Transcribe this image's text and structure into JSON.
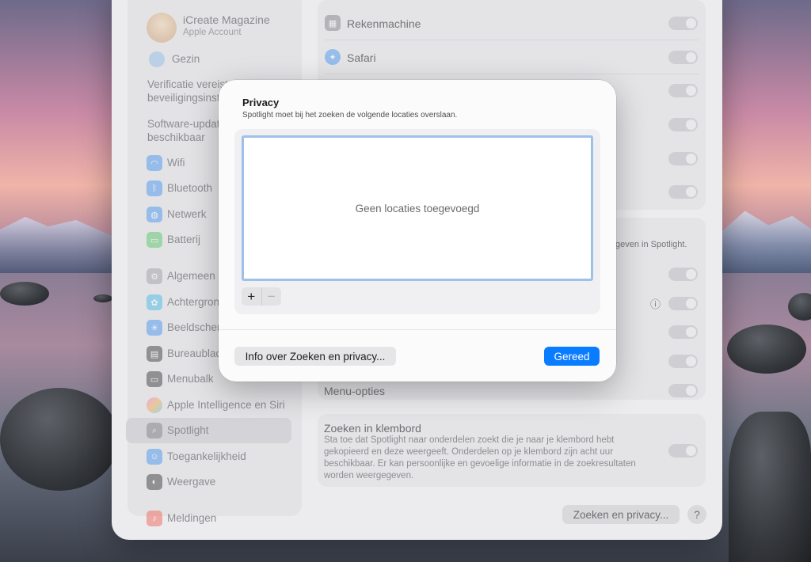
{
  "sidebar": {
    "account_name": "iCreate Magazine",
    "account_sub": "Apple Account",
    "family": "Gezin",
    "notice_1": [
      "Verificatie vereist v",
      "beveiligingsinstelli"
    ],
    "notice_2": [
      "Software-update",
      "beschikbaar"
    ],
    "items": [
      {
        "label": "Wifi",
        "icon": "wifi-icon"
      },
      {
        "label": "Bluetooth",
        "icon": "bluetooth-icon"
      },
      {
        "label": "Netwerk",
        "icon": "globe-icon"
      },
      {
        "label": "Batterij",
        "icon": "battery-icon"
      },
      {
        "label": "Algemeen",
        "icon": "gear-icon"
      },
      {
        "label": "Achtergrond",
        "icon": "flower-icon"
      },
      {
        "label": "Beeldscherm",
        "icon": "sun-icon"
      },
      {
        "label": "Bureaublad en",
        "icon": "desktop-icon"
      },
      {
        "label": "Menubalk",
        "icon": "menubar-icon"
      },
      {
        "label": "Apple Intelligence en Siri",
        "icon": "siri-icon"
      },
      {
        "label": "Spotlight",
        "icon": "magnifier-icon"
      },
      {
        "label": "Toegankelijkheid",
        "icon": "accessibility-icon"
      },
      {
        "label": "Weergave",
        "icon": "appearance-icon"
      },
      {
        "label": "Meldingen",
        "icon": "bell-icon"
      }
    ],
    "selected": "Spotlight"
  },
  "content": {
    "rows_top": [
      "Rekenmachine",
      "Safari"
    ],
    "spotlight_partial": "geven in Spotlight.",
    "menu_options": "Menu-opties",
    "clipboard": {
      "title": "Zoeken in klembord",
      "description": [
        "Sta toe dat Spotlight naar onderdelen zoekt die je naar je klembord hebt",
        "gekopieerd en deze weergeeft. Onderdelen op je klembord zijn acht uur",
        "beschikbaar. Er kan persoonlijke en gevoelige informatie in de zoekresultaten",
        "worden weergegeven."
      ]
    },
    "privacy_button": "Zoeken en privacy...",
    "help_button": "?"
  },
  "modal": {
    "title": "Privacy",
    "subtitle": "Spotlight moet bij het zoeken de volgende locaties overslaan.",
    "empty_text": "Geen locaties toegevoegd",
    "plus": "+",
    "minus": "−",
    "info_button": "Info over Zoeken en privacy...",
    "done_button": "Gereed",
    "colors": {
      "accent": "#0a7cff",
      "focus_ring": "#9fc0ea"
    }
  }
}
